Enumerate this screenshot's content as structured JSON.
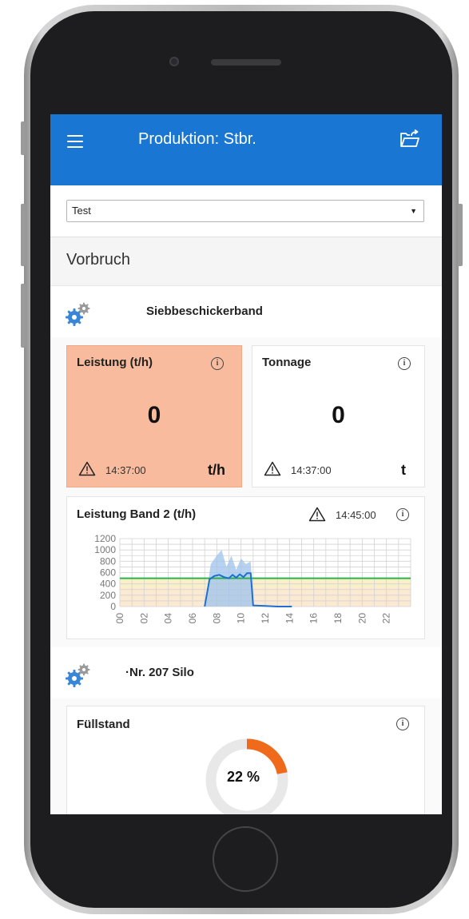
{
  "app": {
    "title": "Produktion: Stbr."
  },
  "select": {
    "value": "Test"
  },
  "section": {
    "title": "Vorbruch"
  },
  "devices": [
    {
      "name": "Siebbeschickerband",
      "icon": "gears-icon",
      "tiles": [
        {
          "label": "Leistung (t/h)",
          "value": "0",
          "time": "14:37:00",
          "unit": "t/h",
          "status": "alert"
        },
        {
          "label": "Tonnage",
          "value": "0",
          "time": "14:37:00",
          "unit": "t",
          "status": "normal"
        }
      ],
      "chart": {
        "label": "Leistung Band 2 (t/h)",
        "time": "14:45:00"
      }
    },
    {
      "name": "·Nr. 207 Silo",
      "icon": "gears-icon",
      "fill": {
        "label": "Füllstand",
        "value_text": "22 %",
        "percent": 22
      }
    }
  ],
  "colors": {
    "appbar": "#1976d2",
    "alert_tile": "#f9bb9d",
    "target_line": "#2bb24c",
    "series_line": "#1e6fd0",
    "band_fill": "#9fc3ec",
    "donut_fill": "#ef6a1a",
    "donut_track": "#e8e8e8"
  },
  "chart_data": {
    "type": "line",
    "x_ticks": [
      "00",
      "02",
      "04",
      "06",
      "08",
      "10",
      "12",
      "14",
      "16",
      "18",
      "20",
      "22"
    ],
    "y_ticks": [
      "1200",
      "1000",
      "800",
      "600",
      "400",
      "200",
      "0"
    ],
    "ylim": [
      0,
      1200
    ],
    "xlim": [
      0,
      24
    ],
    "grid": true,
    "target_line": 500,
    "series": [
      {
        "values": [
          [
            7.0,
            0
          ],
          [
            7.4,
            480
          ],
          [
            7.8,
            540
          ],
          [
            8.2,
            560
          ],
          [
            8.6,
            520
          ],
          [
            9.0,
            500
          ],
          [
            9.3,
            560
          ],
          [
            9.6,
            510
          ],
          [
            9.9,
            570
          ],
          [
            10.2,
            520
          ],
          [
            10.5,
            590
          ],
          [
            10.8,
            590
          ],
          [
            11.0,
            20
          ],
          [
            12.0,
            10
          ],
          [
            13.0,
            0
          ],
          [
            14.2,
            0
          ]
        ]
      }
    ],
    "band": {
      "values": [
        [
          7.0,
          0
        ],
        [
          7.5,
          750
        ],
        [
          8.0,
          900
        ],
        [
          8.4,
          1000
        ],
        [
          8.8,
          700
        ],
        [
          9.2,
          900
        ],
        [
          9.6,
          650
        ],
        [
          10.0,
          850
        ],
        [
          10.4,
          750
        ],
        [
          10.8,
          800
        ],
        [
          11.0,
          0
        ]
      ]
    }
  }
}
